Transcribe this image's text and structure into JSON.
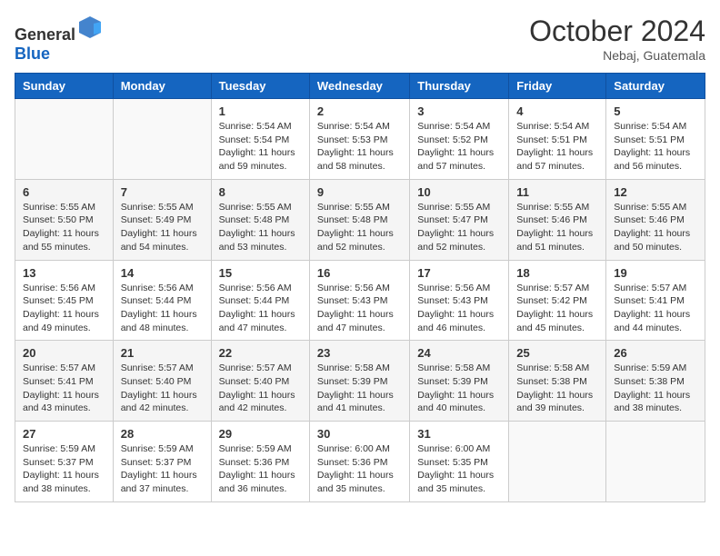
{
  "header": {
    "logo": {
      "text_general": "General",
      "text_blue": "Blue"
    },
    "month_title": "October 2024",
    "location": "Nebaj, Guatemala"
  },
  "weekdays": [
    "Sunday",
    "Monday",
    "Tuesday",
    "Wednesday",
    "Thursday",
    "Friday",
    "Saturday"
  ],
  "weeks": [
    [
      {
        "day": "",
        "info": ""
      },
      {
        "day": "",
        "info": ""
      },
      {
        "day": "1",
        "info": "Sunrise: 5:54 AM\nSunset: 5:54 PM\nDaylight: 11 hours and 59 minutes."
      },
      {
        "day": "2",
        "info": "Sunrise: 5:54 AM\nSunset: 5:53 PM\nDaylight: 11 hours and 58 minutes."
      },
      {
        "day": "3",
        "info": "Sunrise: 5:54 AM\nSunset: 5:52 PM\nDaylight: 11 hours and 57 minutes."
      },
      {
        "day": "4",
        "info": "Sunrise: 5:54 AM\nSunset: 5:51 PM\nDaylight: 11 hours and 57 minutes."
      },
      {
        "day": "5",
        "info": "Sunrise: 5:54 AM\nSunset: 5:51 PM\nDaylight: 11 hours and 56 minutes."
      }
    ],
    [
      {
        "day": "6",
        "info": "Sunrise: 5:55 AM\nSunset: 5:50 PM\nDaylight: 11 hours and 55 minutes."
      },
      {
        "day": "7",
        "info": "Sunrise: 5:55 AM\nSunset: 5:49 PM\nDaylight: 11 hours and 54 minutes."
      },
      {
        "day": "8",
        "info": "Sunrise: 5:55 AM\nSunset: 5:48 PM\nDaylight: 11 hours and 53 minutes."
      },
      {
        "day": "9",
        "info": "Sunrise: 5:55 AM\nSunset: 5:48 PM\nDaylight: 11 hours and 52 minutes."
      },
      {
        "day": "10",
        "info": "Sunrise: 5:55 AM\nSunset: 5:47 PM\nDaylight: 11 hours and 52 minutes."
      },
      {
        "day": "11",
        "info": "Sunrise: 5:55 AM\nSunset: 5:46 PM\nDaylight: 11 hours and 51 minutes."
      },
      {
        "day": "12",
        "info": "Sunrise: 5:55 AM\nSunset: 5:46 PM\nDaylight: 11 hours and 50 minutes."
      }
    ],
    [
      {
        "day": "13",
        "info": "Sunrise: 5:56 AM\nSunset: 5:45 PM\nDaylight: 11 hours and 49 minutes."
      },
      {
        "day": "14",
        "info": "Sunrise: 5:56 AM\nSunset: 5:44 PM\nDaylight: 11 hours and 48 minutes."
      },
      {
        "day": "15",
        "info": "Sunrise: 5:56 AM\nSunset: 5:44 PM\nDaylight: 11 hours and 47 minutes."
      },
      {
        "day": "16",
        "info": "Sunrise: 5:56 AM\nSunset: 5:43 PM\nDaylight: 11 hours and 47 minutes."
      },
      {
        "day": "17",
        "info": "Sunrise: 5:56 AM\nSunset: 5:43 PM\nDaylight: 11 hours and 46 minutes."
      },
      {
        "day": "18",
        "info": "Sunrise: 5:57 AM\nSunset: 5:42 PM\nDaylight: 11 hours and 45 minutes."
      },
      {
        "day": "19",
        "info": "Sunrise: 5:57 AM\nSunset: 5:41 PM\nDaylight: 11 hours and 44 minutes."
      }
    ],
    [
      {
        "day": "20",
        "info": "Sunrise: 5:57 AM\nSunset: 5:41 PM\nDaylight: 11 hours and 43 minutes."
      },
      {
        "day": "21",
        "info": "Sunrise: 5:57 AM\nSunset: 5:40 PM\nDaylight: 11 hours and 42 minutes."
      },
      {
        "day": "22",
        "info": "Sunrise: 5:57 AM\nSunset: 5:40 PM\nDaylight: 11 hours and 42 minutes."
      },
      {
        "day": "23",
        "info": "Sunrise: 5:58 AM\nSunset: 5:39 PM\nDaylight: 11 hours and 41 minutes."
      },
      {
        "day": "24",
        "info": "Sunrise: 5:58 AM\nSunset: 5:39 PM\nDaylight: 11 hours and 40 minutes."
      },
      {
        "day": "25",
        "info": "Sunrise: 5:58 AM\nSunset: 5:38 PM\nDaylight: 11 hours and 39 minutes."
      },
      {
        "day": "26",
        "info": "Sunrise: 5:59 AM\nSunset: 5:38 PM\nDaylight: 11 hours and 38 minutes."
      }
    ],
    [
      {
        "day": "27",
        "info": "Sunrise: 5:59 AM\nSunset: 5:37 PM\nDaylight: 11 hours and 38 minutes."
      },
      {
        "day": "28",
        "info": "Sunrise: 5:59 AM\nSunset: 5:37 PM\nDaylight: 11 hours and 37 minutes."
      },
      {
        "day": "29",
        "info": "Sunrise: 5:59 AM\nSunset: 5:36 PM\nDaylight: 11 hours and 36 minutes."
      },
      {
        "day": "30",
        "info": "Sunrise: 6:00 AM\nSunset: 5:36 PM\nDaylight: 11 hours and 35 minutes."
      },
      {
        "day": "31",
        "info": "Sunrise: 6:00 AM\nSunset: 5:35 PM\nDaylight: 11 hours and 35 minutes."
      },
      {
        "day": "",
        "info": ""
      },
      {
        "day": "",
        "info": ""
      }
    ]
  ]
}
